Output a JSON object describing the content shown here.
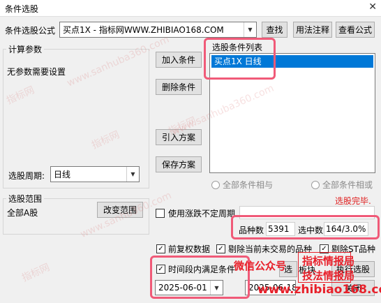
{
  "window": {
    "title": "条件选股",
    "close_glyph": "✕"
  },
  "formula_row": {
    "label": "条件选股公式",
    "formula_value": "买点1X     - 指标网WWW.ZHIBIAO168.COM",
    "find_button": "查找",
    "usage_button": "用法注释",
    "view_formula_button": "查看公式"
  },
  "params": {
    "group_title": "计算参数",
    "no_params_text": "无参数需要设置",
    "period_label": "选股周期:",
    "period_value": "日线"
  },
  "condition_buttons": {
    "add": "加入条件",
    "delete": "删除条件",
    "import_plan": "引入方案",
    "save_plan": "保存方案"
  },
  "condition_list": {
    "title": "选股条件列表",
    "items": [
      "买点1X  日线"
    ]
  },
  "logic": {
    "and_label": "全部条件相与",
    "or_label": "全部条件相或"
  },
  "status_text": "选股完毕.",
  "range": {
    "group_title": "选股范围",
    "value": "全部A股",
    "change_button": "改变范围"
  },
  "indefinite_period": {
    "label": "使用涨跌不定周期",
    "checked": false
  },
  "stats": {
    "count_label": "品种数",
    "count_value": "5391",
    "selected_label": "选中数",
    "selected_value": "164/3.0%"
  },
  "options": {
    "adjusted": {
      "label": "前复权数据",
      "checked": true
    },
    "exclude_untraded": {
      "label": "剔除当前未交易的品种",
      "checked": true
    },
    "exclude_st": {
      "label": "剔除ST品种",
      "checked": true
    }
  },
  "time_range": {
    "label": "时间段内满足条件",
    "checked": true,
    "start": "2025-06-01",
    "end": "2025-06-18"
  },
  "action_buttons": {
    "sector": "板块",
    "execute": "执行选股",
    "close": "关闭",
    "pre_select_partial": "选"
  },
  "watermarks": {
    "site": "指标网",
    "domain": "www.sanhuba360.com",
    "domain_short": "www.sanhu360.com"
  },
  "overlay": {
    "wechat": "微信公众号",
    "brand_top": "指标情报局",
    "brand_bottom": "技法情报局",
    "url": "www.zhibiao168.com"
  },
  "colors": {
    "highlight_box": "#f05a78",
    "selection": "#0078d7",
    "status_red": "#e02020",
    "overlay_red": "#e8202a"
  }
}
